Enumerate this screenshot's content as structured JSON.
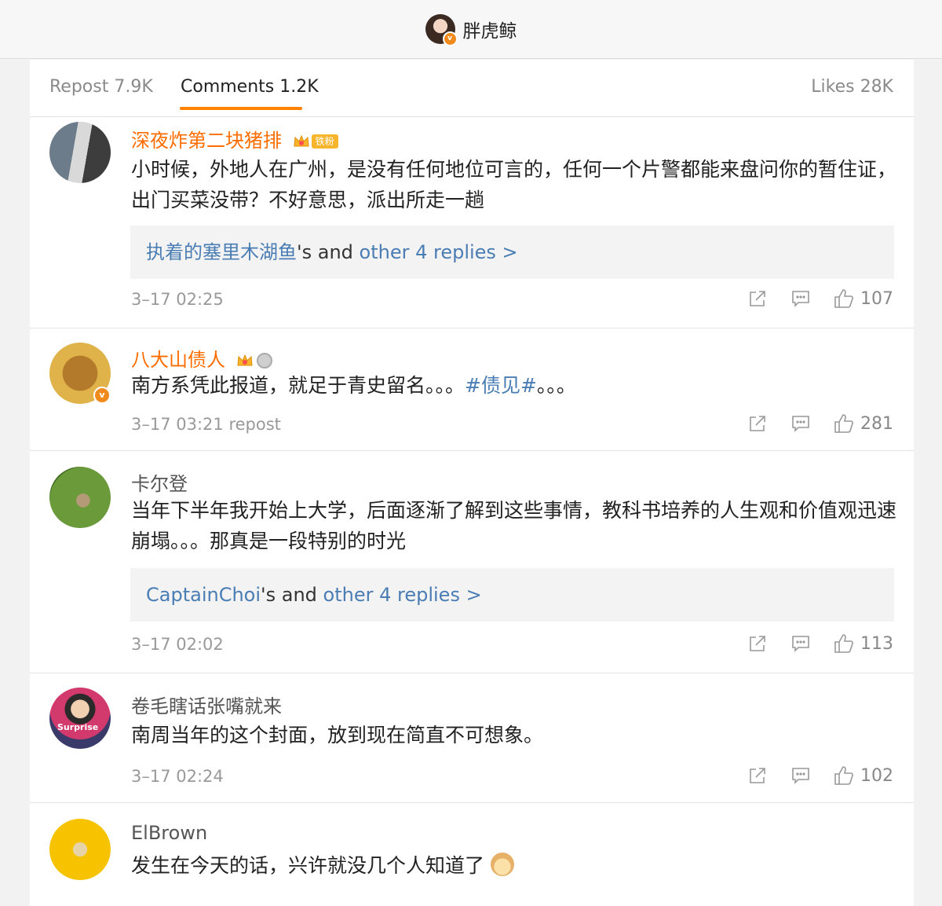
{
  "header": {
    "username": "胖虎鲸"
  },
  "tabs": {
    "repost": "Repost 7.9K",
    "comments": "Comments 1.2K",
    "likes": "Likes 28K"
  },
  "comments": [
    {
      "username": "深夜炸第二块猪排",
      "fan_badge": "铁粉",
      "text": "小时候，外地人在广州，是没有任何地位可言的，任何一个片警都能来盘问你的暂住证，出门买菜没带？不好意思，派出所走一趟",
      "reply_user": "执着的塞里木湖鱼",
      "reply_mid": "'s and ",
      "reply_more": "other 4 replies >",
      "time": "3–17 02:25",
      "likes": "107"
    },
    {
      "username": "八大山债人",
      "text_a": "南方系凭此报道，就足于青史留名。。。",
      "topic": "#债见#",
      "text_b": "。。。",
      "time": "3–17 03:21 repost",
      "likes": "281"
    },
    {
      "username": "卡尔登",
      "text": "当年下半年我开始上大学，后面逐渐了解到这些事情，教科书培养的人生观和价值观迅速崩塌。。。那真是一段特别的时光",
      "reply_user": "CaptainChoi",
      "reply_mid": "'s and ",
      "reply_more": "other 4 replies >",
      "time": "3–17 02:02",
      "likes": "113"
    },
    {
      "username": "卷毛瞎话张嘴就来",
      "avatar_text": "Surprise",
      "text": "南周当年的这个封面，放到现在简直不可想象。",
      "time": "3–17 02:24",
      "likes": "102"
    },
    {
      "username": "ElBrown",
      "text": "发生在今天的话，兴许就没几个人知道了"
    }
  ],
  "colors": {
    "accent": "#ff8200",
    "link": "#4a7db3",
    "username_orange": "#ff6c00"
  }
}
